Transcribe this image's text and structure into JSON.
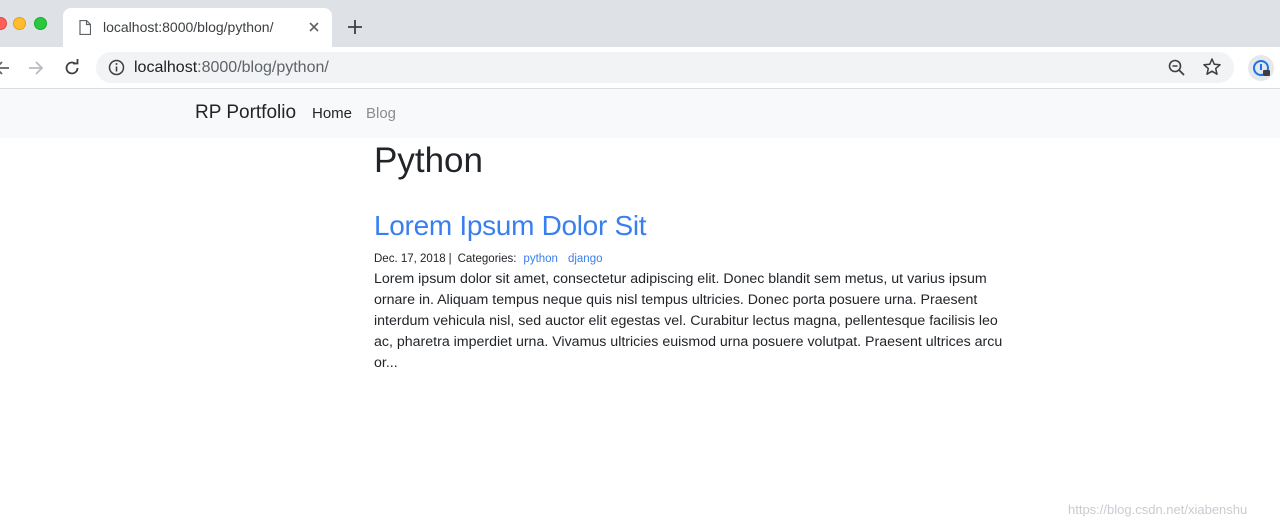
{
  "browser": {
    "tab_title": "localhost:8000/blog/python/",
    "url_host": "localhost",
    "url_rest": ":8000/blog/python/",
    "icons": [
      "page-icon",
      "close-icon",
      "plus-icon",
      "back-arrow-icon",
      "forward-arrow-icon",
      "reload-icon",
      "info-icon",
      "zoom-out-icon",
      "star-icon",
      "extension-icon"
    ]
  },
  "navbar": {
    "brand": "RP Portfolio",
    "links": [
      {
        "label": "Home"
      },
      {
        "label": "Blog"
      }
    ]
  },
  "page": {
    "title": "Python"
  },
  "post": {
    "title": "Lorem Ipsum Dolor Sit",
    "date": "Dec. 17, 2018",
    "separator": "|",
    "categories_label": "Categories:",
    "categories": [
      "python",
      "django"
    ],
    "excerpt": "Lorem ipsum dolor sit amet, consectetur adipiscing elit. Donec blandit sem metus, ut varius ipsum ornare in. Aliquam tempus neque quis nisl tempus ultricies. Donec porta posuere urna. Praesent interdum vehicula nisl, sed auctor elit egestas vel. Curabitur lectus magna, pellentesque facilisis leo ac, pharetra imperdiet urna. Vivamus ultricies euismod urna posuere volutpat. Praesent ultrices arcu or..."
  },
  "watermark": "https://blog.csdn.net/xiabenshu",
  "colors": {
    "link": "#3a7ff0",
    "navbar_bg": "#f8f9fa",
    "tabstrip_bg": "#dee1e6"
  }
}
